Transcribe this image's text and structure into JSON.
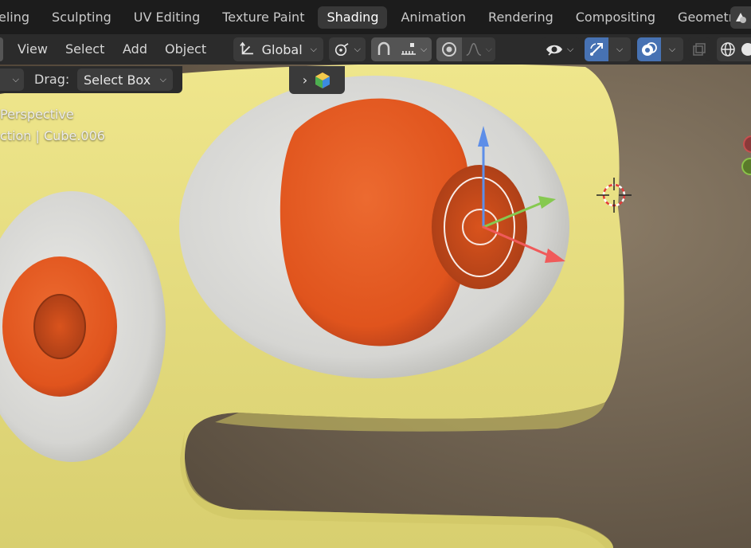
{
  "workspace_tabs": [
    "eling",
    "Sculpting",
    "UV Editing",
    "Texture Paint",
    "Shading",
    "Animation",
    "Rendering",
    "Compositing",
    "Geometr"
  ],
  "active_tab": "Shading",
  "header": {
    "menus": [
      "View",
      "Select",
      "Add",
      "Object"
    ],
    "transform_orientation": "Global"
  },
  "tool_settings": {
    "drag_label": "Drag:",
    "drag_value": "Select Box"
  },
  "viewport": {
    "view_name": "Perspective",
    "context_text": "ction | Cube.006"
  },
  "icons": [
    "orientation-icon",
    "chevron-down-icon",
    "pivot-icon",
    "snap-icon",
    "snap-increment-icon",
    "proportional-edit-icon",
    "falloff-curve-icon",
    "visibility-eye-icon",
    "gizmo-icon",
    "overlay-icon",
    "xray-icon",
    "wireframe-shading-icon",
    "material-color-icon",
    "light-cursor-icon"
  ],
  "colors": {
    "active_blue": "#4772b3",
    "object_yellow": "#e8e07e",
    "eye_orange": "#e2541f",
    "eye_white": "#dcdcd8"
  }
}
